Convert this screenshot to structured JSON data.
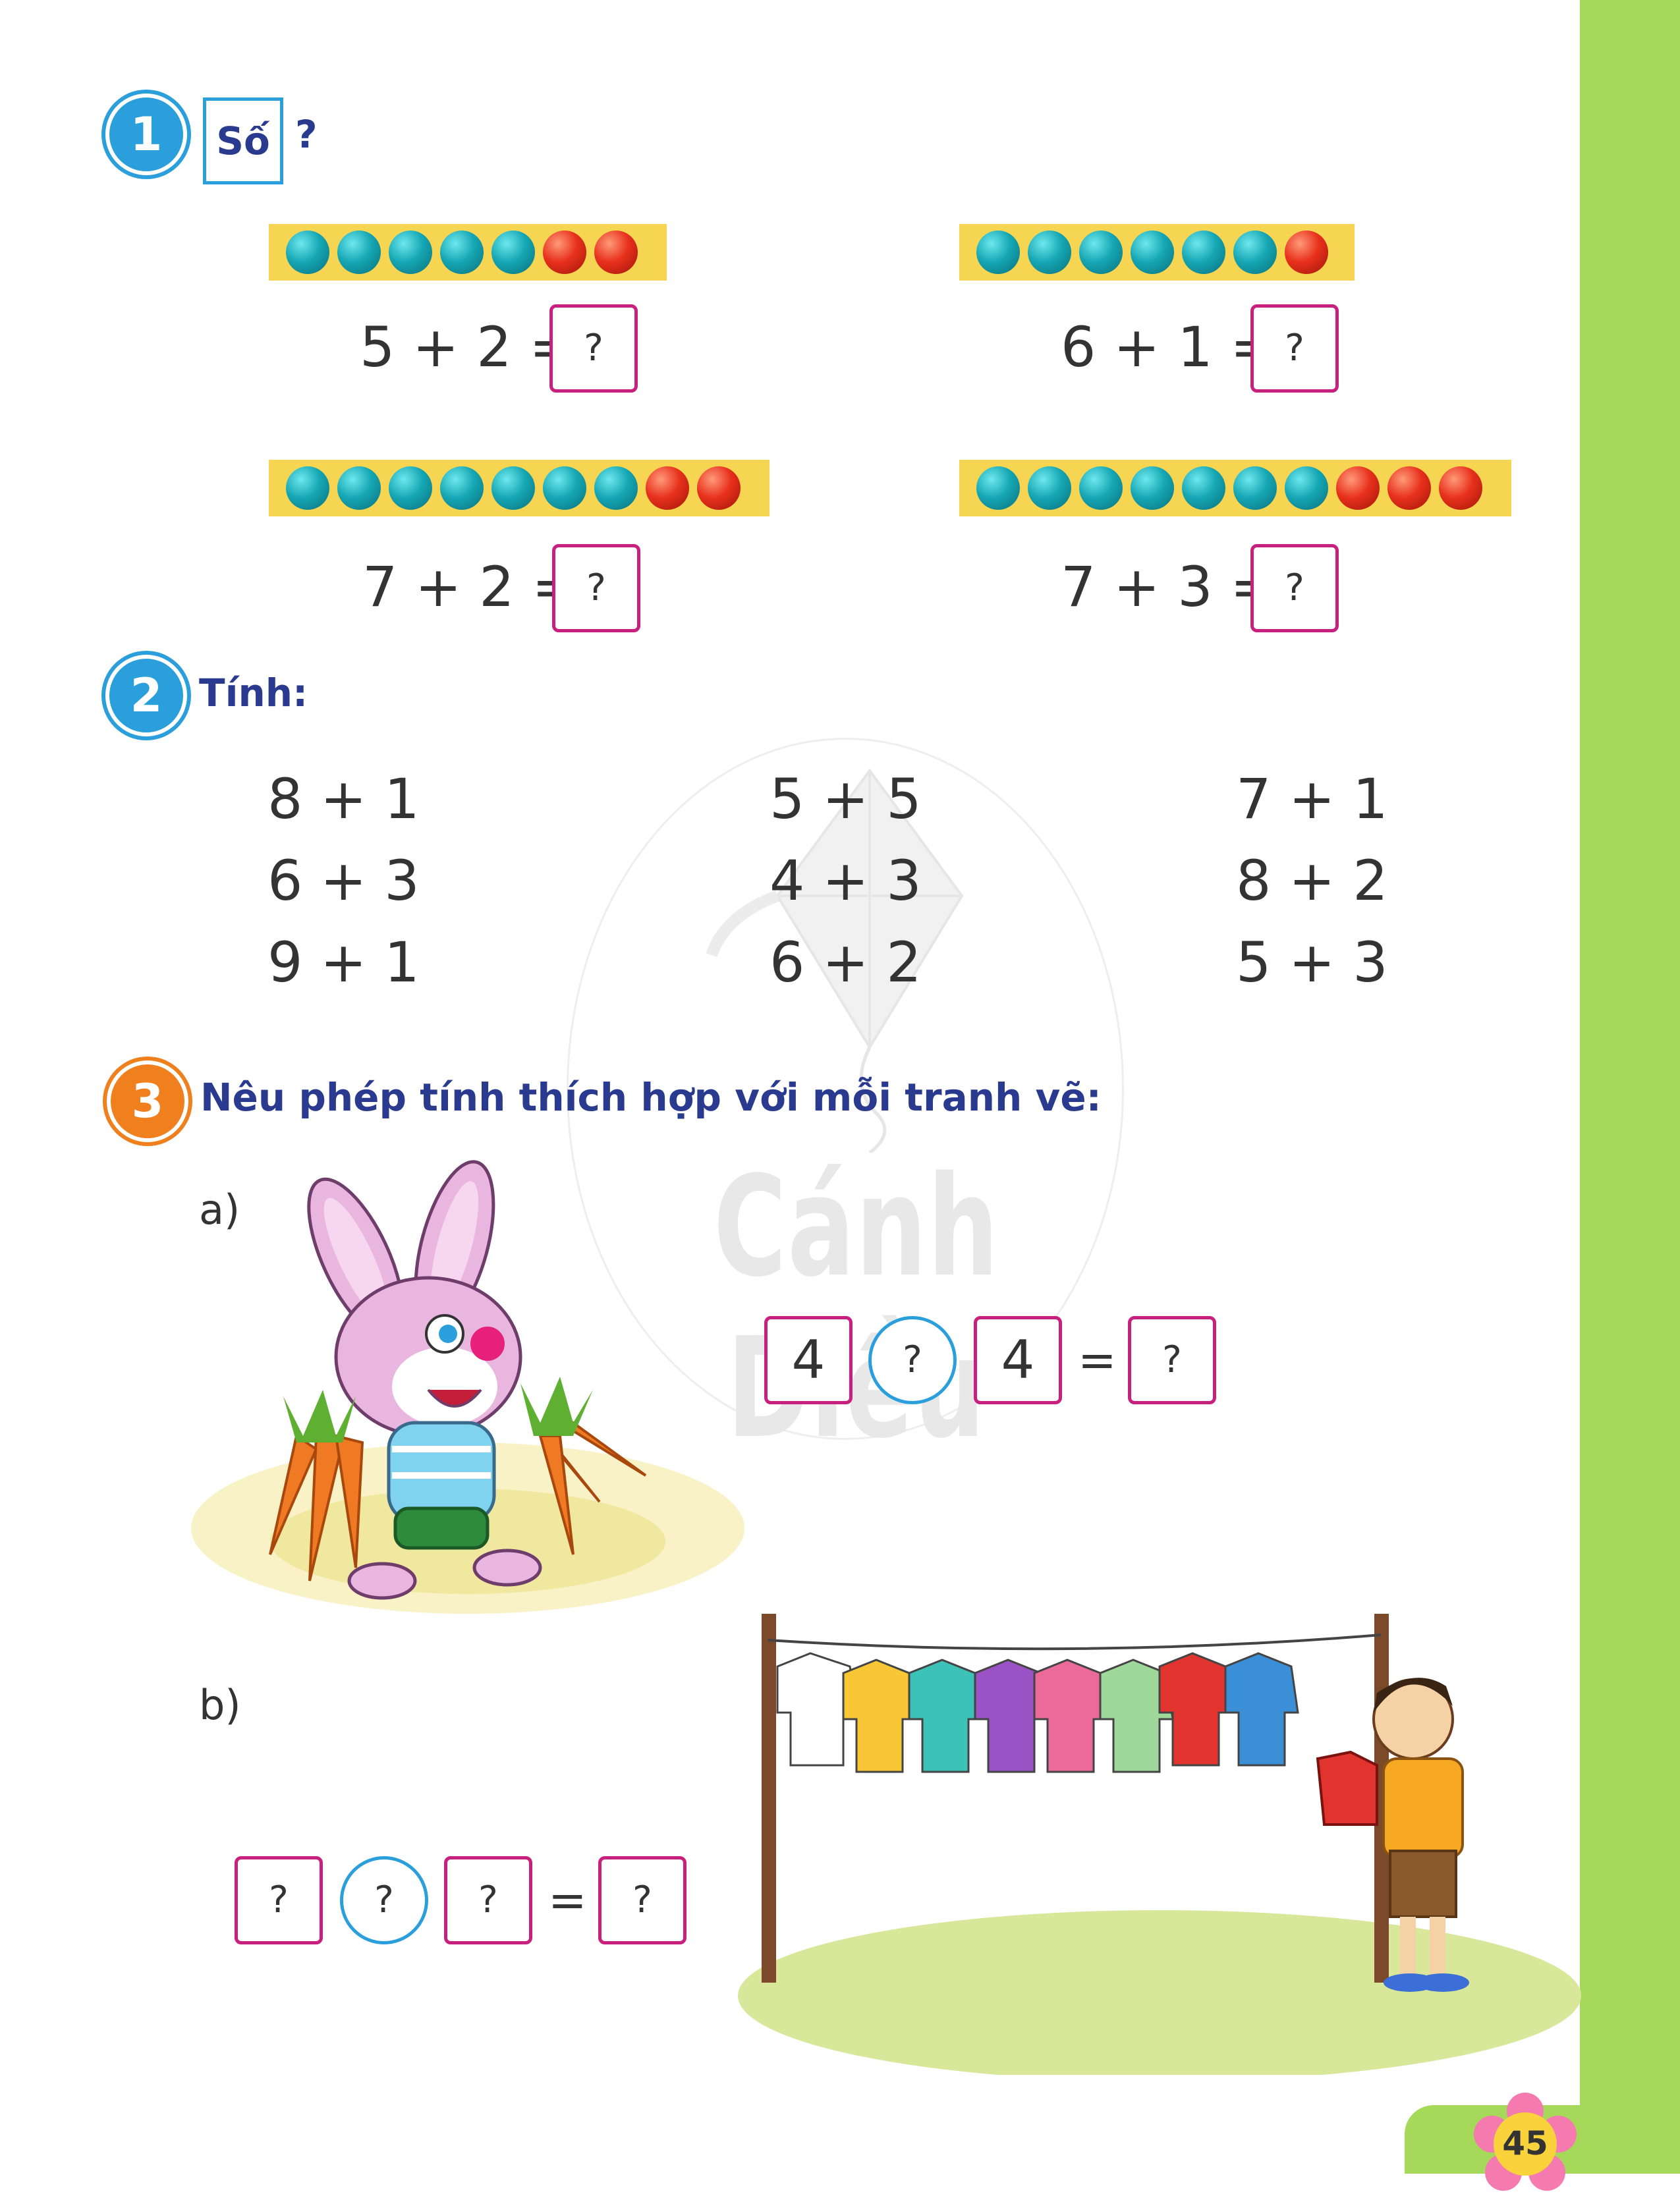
{
  "exercise1": {
    "number": "1",
    "so_label": "Số",
    "question_mark": "?",
    "problems": [
      {
        "expr": "5 + 2 =",
        "answer": "?",
        "teal": 5,
        "red": 2
      },
      {
        "expr": "6 + 1 =",
        "answer": "?",
        "teal": 6,
        "red": 1
      },
      {
        "expr": "7 + 2 =",
        "answer": "?",
        "teal": 7,
        "red": 2
      },
      {
        "expr": "7 + 3 =",
        "answer": "?",
        "teal": 7,
        "red": 3
      }
    ]
  },
  "exercise2": {
    "number": "2",
    "title": "Tính:",
    "columns": [
      [
        "8 + 1",
        "6 + 3",
        "9 + 1"
      ],
      [
        "5 + 5",
        "4 + 3",
        "6 + 2"
      ],
      [
        "7 + 1",
        "8 + 2",
        "5 + 3"
      ]
    ]
  },
  "exercise3": {
    "number": "3",
    "title": "Nêu phép tính thích hợp với mỗi tranh vẽ:",
    "part_a": {
      "label": "a)",
      "left": "4",
      "operator": "?",
      "right": "4",
      "equals": "=",
      "result": "?"
    },
    "part_b": {
      "label": "b)",
      "left": "?",
      "operator": "?",
      "right": "?",
      "equals": "=",
      "result": "?"
    }
  },
  "watermark": "Cánh Diều",
  "page_number": "45",
  "colors": {
    "sidebar": "#a6d85a",
    "heading": "#2a3b8f",
    "circle_blue": "#2a9fdb",
    "circle_orange": "#f07f1e",
    "box_magenta": "#c8207e",
    "bead_bar": "#f6d552"
  }
}
